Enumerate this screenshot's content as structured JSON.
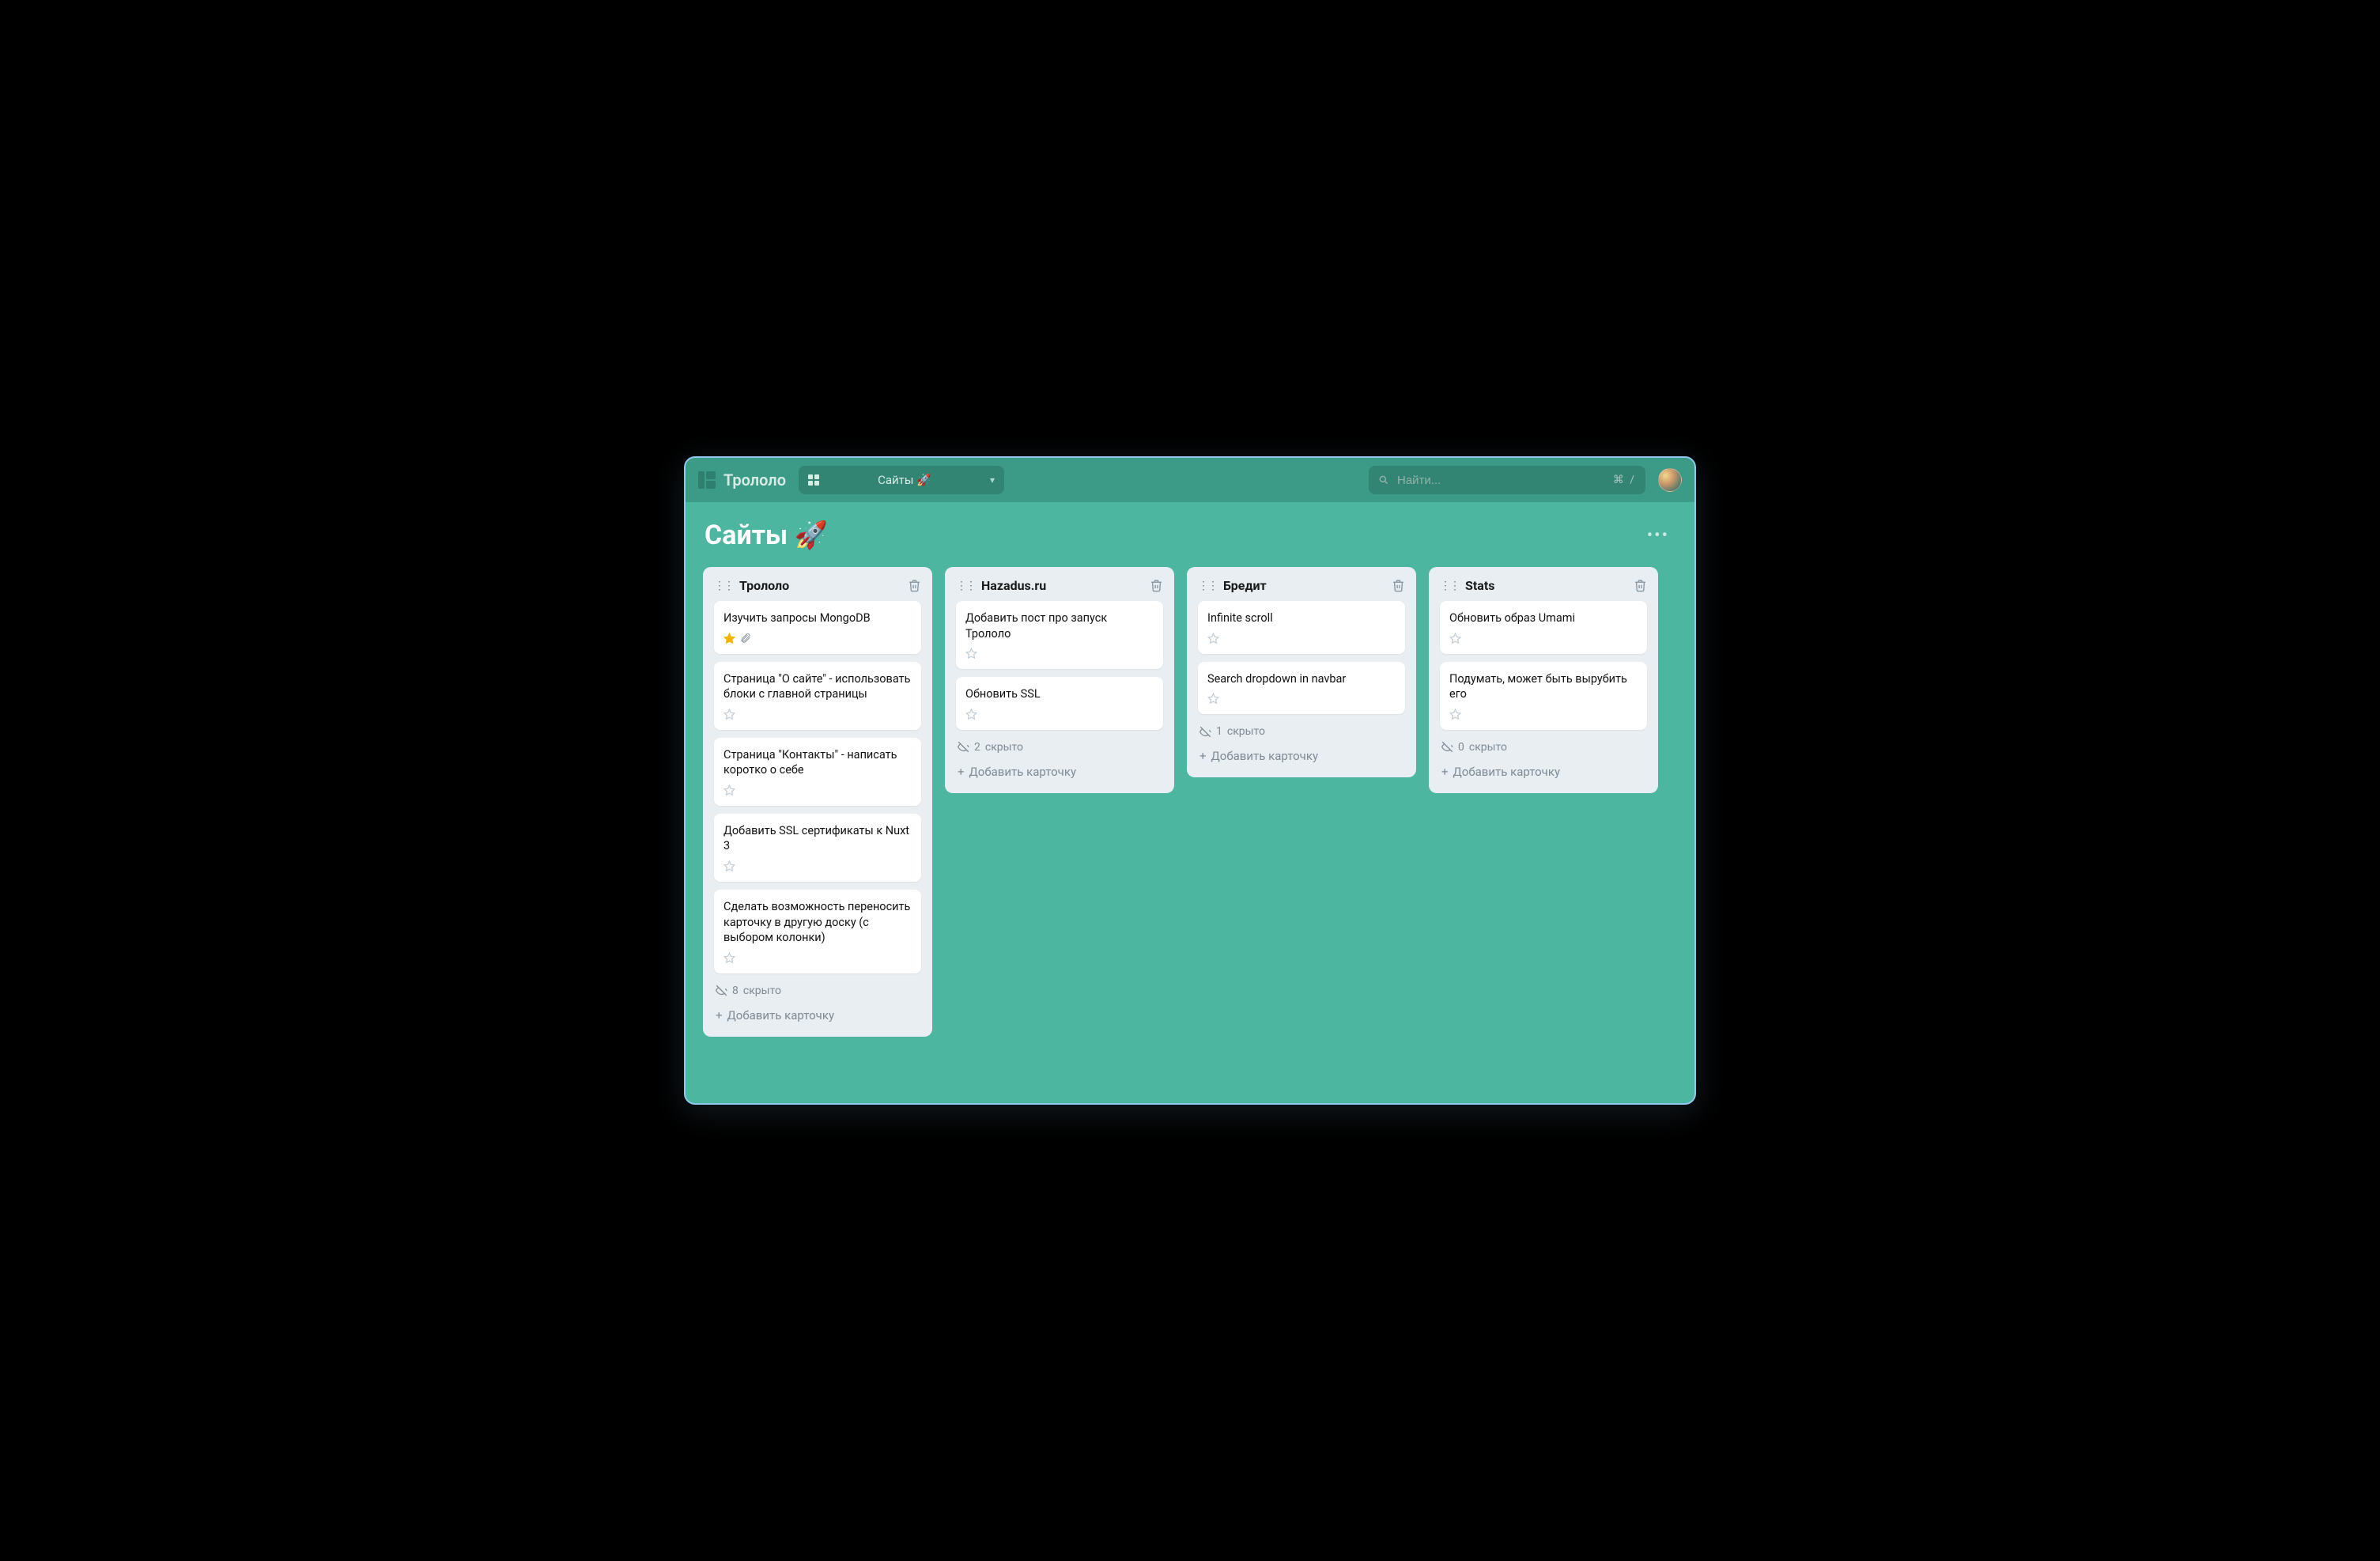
{
  "app": {
    "name": "Трололо"
  },
  "boardSwitcher": {
    "label": "Сайты 🚀"
  },
  "search": {
    "placeholder": "Найти...",
    "shortcut": "⌘ /"
  },
  "board": {
    "title": "Сайты 🚀",
    "addCardLabel": "Добавить карточку",
    "hiddenWord": "скрыто"
  },
  "lists": [
    {
      "title": "Трололо",
      "hiddenCount": 8,
      "cards": [
        {
          "title": "Изучить запросы MongoDB",
          "starred": true,
          "attachment": true
        },
        {
          "title": "Страница \"О сайте\" - использовать блоки с главной страницы",
          "starred": false,
          "attachment": false
        },
        {
          "title": "Страница \"Контакты\" - написать коротко о себе",
          "starred": false,
          "attachment": false
        },
        {
          "title": "Добавить SSL сертификаты к Nuxt 3",
          "starred": false,
          "attachment": false
        },
        {
          "title": "Сделать возможность переносить карточку в другую доску (с выбором колонки)",
          "starred": false,
          "attachment": false
        }
      ]
    },
    {
      "title": "Hazadus.ru",
      "hiddenCount": 2,
      "cards": [
        {
          "title": "Добавить пост про запуск Трололо",
          "starred": false,
          "attachment": false
        },
        {
          "title": "Обновить SSL",
          "starred": false,
          "attachment": false
        }
      ]
    },
    {
      "title": "Бредит",
      "hiddenCount": 1,
      "cards": [
        {
          "title": "Infinite scroll",
          "starred": false,
          "attachment": false
        },
        {
          "title": "Search dropdown in navbar",
          "starred": false,
          "attachment": false
        }
      ]
    },
    {
      "title": "Stats",
      "hiddenCount": 0,
      "cards": [
        {
          "title": "Обновить образ Umami",
          "starred": false,
          "attachment": false
        },
        {
          "title": "Подумать, может быть вырубить его",
          "starred": false,
          "attachment": false
        }
      ]
    }
  ]
}
